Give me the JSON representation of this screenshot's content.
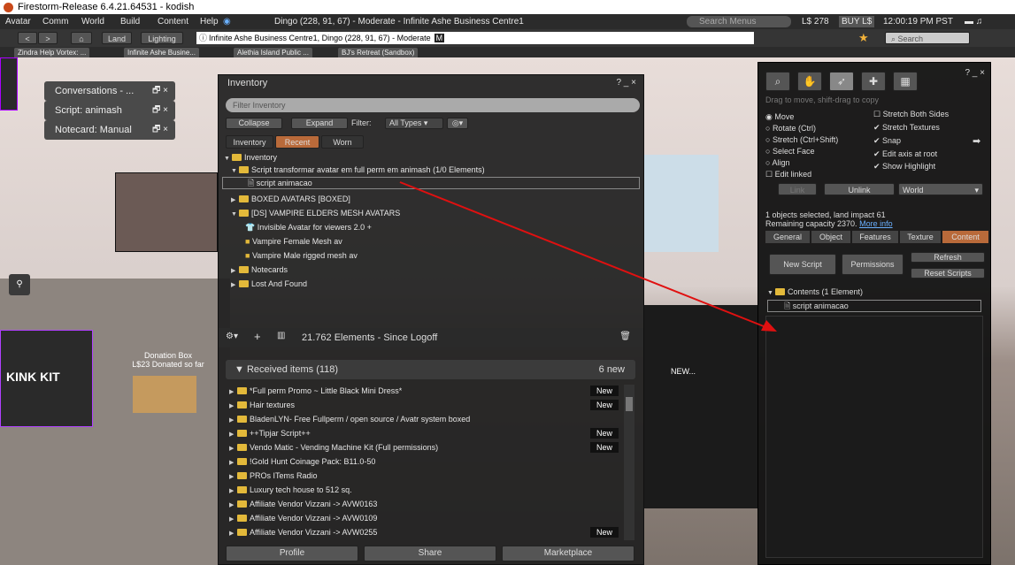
{
  "window_title": "Firestorm-Release 6.4.21.64531 - kodish",
  "menu": [
    "Avatar",
    "Comm",
    "World",
    "Build",
    "Content",
    "Help"
  ],
  "menu_location": "Dingo (228, 91, 67) - Moderate - Infinite Ashe Business Centre1",
  "search_menus": "Search Menus",
  "balance": "L$ 278",
  "buy": "BUY L$",
  "clock": "12:00:19 PM PST",
  "nav": {
    "land": "Land",
    "lighting": "Lighting",
    "location": "Infinite Ashe Business Centre1, Dingo (228, 91, 67) - Moderate",
    "rating": "M",
    "search": "Search"
  },
  "tabs": [
    "Zindra Help Vortex: ...",
    "Infinite Ashe Busine...",
    "Alethia Island Public ...",
    "BJ's Retreat (Sandbox)"
  ],
  "chips": [
    "Conversations - ...",
    "Script: animash",
    "Notecard: Manual"
  ],
  "scene": {
    "donation_title": "Donation Box",
    "donation_text": "L$23 Donated so far",
    "kink": "KINK KIT",
    "new": "NEW..."
  },
  "inventory": {
    "title": "Inventory",
    "help": "? _ ×",
    "filter_placeholder": "Filter Inventory",
    "collapse": "Collapse",
    "expand": "Expand",
    "filter_label": "Filter:",
    "filter_value": "All Types",
    "tabs": [
      "Inventory",
      "Recent",
      "Worn"
    ],
    "tree": [
      {
        "label": "Inventory",
        "indent": 0
      },
      {
        "label": "Script transformar avatar em full perm em animash (1/0 Elements)",
        "indent": 1
      },
      {
        "label": "script animacao",
        "indent": 2
      },
      {
        "label": "BOXED AVATARS [BOXED]",
        "indent": 1
      },
      {
        "label": "[DS] VAMPIRE ELDERS MESH AVATARS",
        "indent": 1
      },
      {
        "label": "Invisible Avatar for viewers 2.0 +",
        "indent": 2
      },
      {
        "label": "Vampire Female Mesh av",
        "indent": 2
      },
      {
        "label": "Vampire Male rigged mesh av",
        "indent": 2
      },
      {
        "label": "Notecards",
        "indent": 1
      },
      {
        "label": "Lost And Found",
        "indent": 1
      }
    ],
    "count": "21.762 Elements  - Since Logoff",
    "received": "Received items (118)",
    "received_new": "6 new",
    "received_items": [
      {
        "label": "*Full perm Promo ~ Little Black Mini Dress*",
        "new": "New"
      },
      {
        "label": "Hair textures",
        "new": "New"
      },
      {
        "label": "BladenLYN- Free Fullperm / open source / Avatr system boxed",
        "new": ""
      },
      {
        "label": "++Tipjar Script++",
        "new": "New"
      },
      {
        "label": "Vendo Matic - Vending Machine Kit (Full permissions)",
        "new": "New"
      },
      {
        "label": "!Gold Hunt Coinage Pack: B11.0-50",
        "new": ""
      },
      {
        "label": "PROs ITems Radio",
        "new": ""
      },
      {
        "label": "Luxury tech house to 512 sq.",
        "new": ""
      },
      {
        "label": "Affiliate Vendor Vizzani -> AVW0163",
        "new": ""
      },
      {
        "label": "Affiliate Vendor Vizzani -> AVW0109",
        "new": ""
      },
      {
        "label": "Affiliate Vendor Vizzani -> AVW0255",
        "new": "New"
      }
    ],
    "footer": [
      "Profile",
      "Share",
      "Marketplace"
    ]
  },
  "build": {
    "hint": "Drag to move, shift-drag to copy",
    "help": "? _ ×",
    "radios": [
      "Move",
      "Rotate (Ctrl)",
      "Stretch (Ctrl+Shift)",
      "Select Face",
      "Align",
      "Edit linked"
    ],
    "checks": [
      "Stretch Both Sides",
      "Stretch Textures",
      "Snap",
      "Edit axis at root",
      "Show Highlight"
    ],
    "link": "Link",
    "unlink": "Unlink",
    "world": "World",
    "selected": "1 objects selected, land impact 61",
    "capacity": "Remaining capacity 2370.",
    "more": "More info",
    "tabs": [
      "General",
      "Object",
      "Features",
      "Texture",
      "Content"
    ],
    "new_script": "New Script",
    "permissions": "Permissions",
    "refresh": "Refresh",
    "reset": "Reset Scripts",
    "contents": "Contents (1 Element)",
    "item": "script animacao"
  }
}
